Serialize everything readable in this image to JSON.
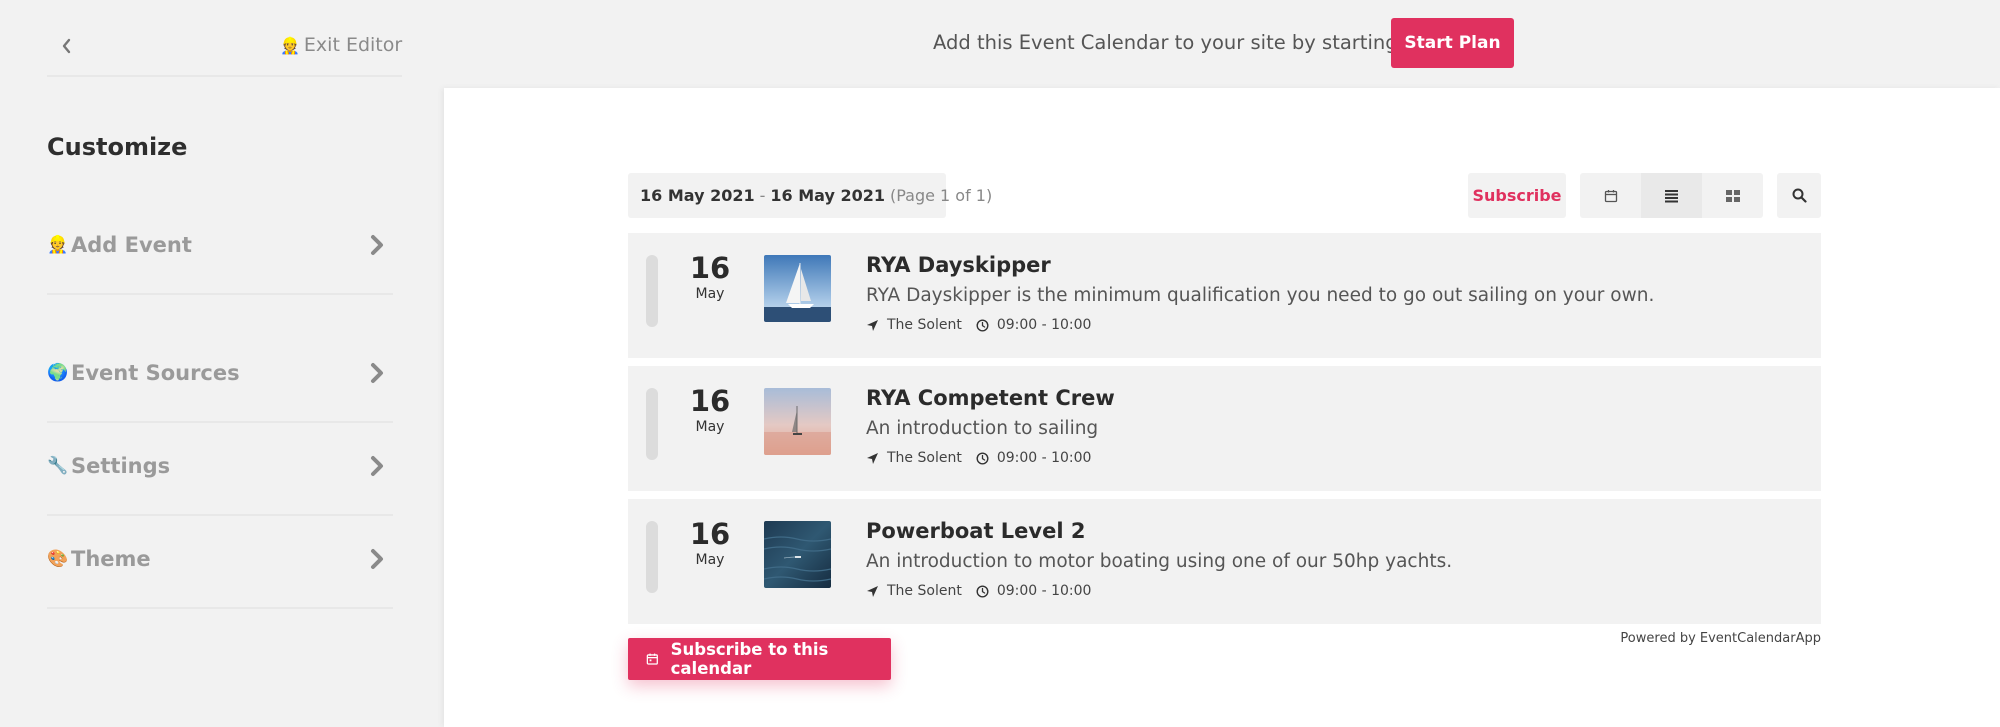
{
  "topbar": {
    "exit_editor_emoji": "👷",
    "exit_editor_label": "Exit Editor",
    "plan_message": "Add this Event Calendar to your site by starting a plan",
    "start_plan_label": "Start Plan"
  },
  "sidebar": {
    "title": "Customize",
    "items": [
      {
        "emoji": "👷",
        "label": "Add Event"
      },
      {
        "emoji": "🌍",
        "label": "Event Sources"
      },
      {
        "emoji": "🔧",
        "label": "Settings"
      },
      {
        "emoji": "🎨",
        "label": "Theme"
      }
    ]
  },
  "calendar": {
    "range_start": "16 May 2021",
    "range_sep": "-",
    "range_end": "16 May 2021",
    "page_info": "(Page 1 of 1)",
    "subscribe_label": "Subscribe",
    "events": [
      {
        "day": "16",
        "month": "May",
        "title": "RYA Dayskipper",
        "description": "RYA Dayskipper is the minimum qualification you need to go out sailing on your own.",
        "location": "The Solent",
        "time": "09:00 - 10:00"
      },
      {
        "day": "16",
        "month": "May",
        "title": "RYA Competent Crew",
        "description": "An introduction to sailing",
        "location": "The Solent",
        "time": "09:00 - 10:00"
      },
      {
        "day": "16",
        "month": "May",
        "title": "Powerboat Level 2",
        "description": "An introduction to motor boating using one of our 50hp yachts.",
        "location": "The Solent",
        "time": "09:00 - 10:00"
      }
    ],
    "powered_by": "Powered by EventCalendarApp",
    "subscribe_calendar_label": "Subscribe to this calendar"
  },
  "colors": {
    "accent": "#e0315f",
    "panel": "#f2f2f2"
  }
}
